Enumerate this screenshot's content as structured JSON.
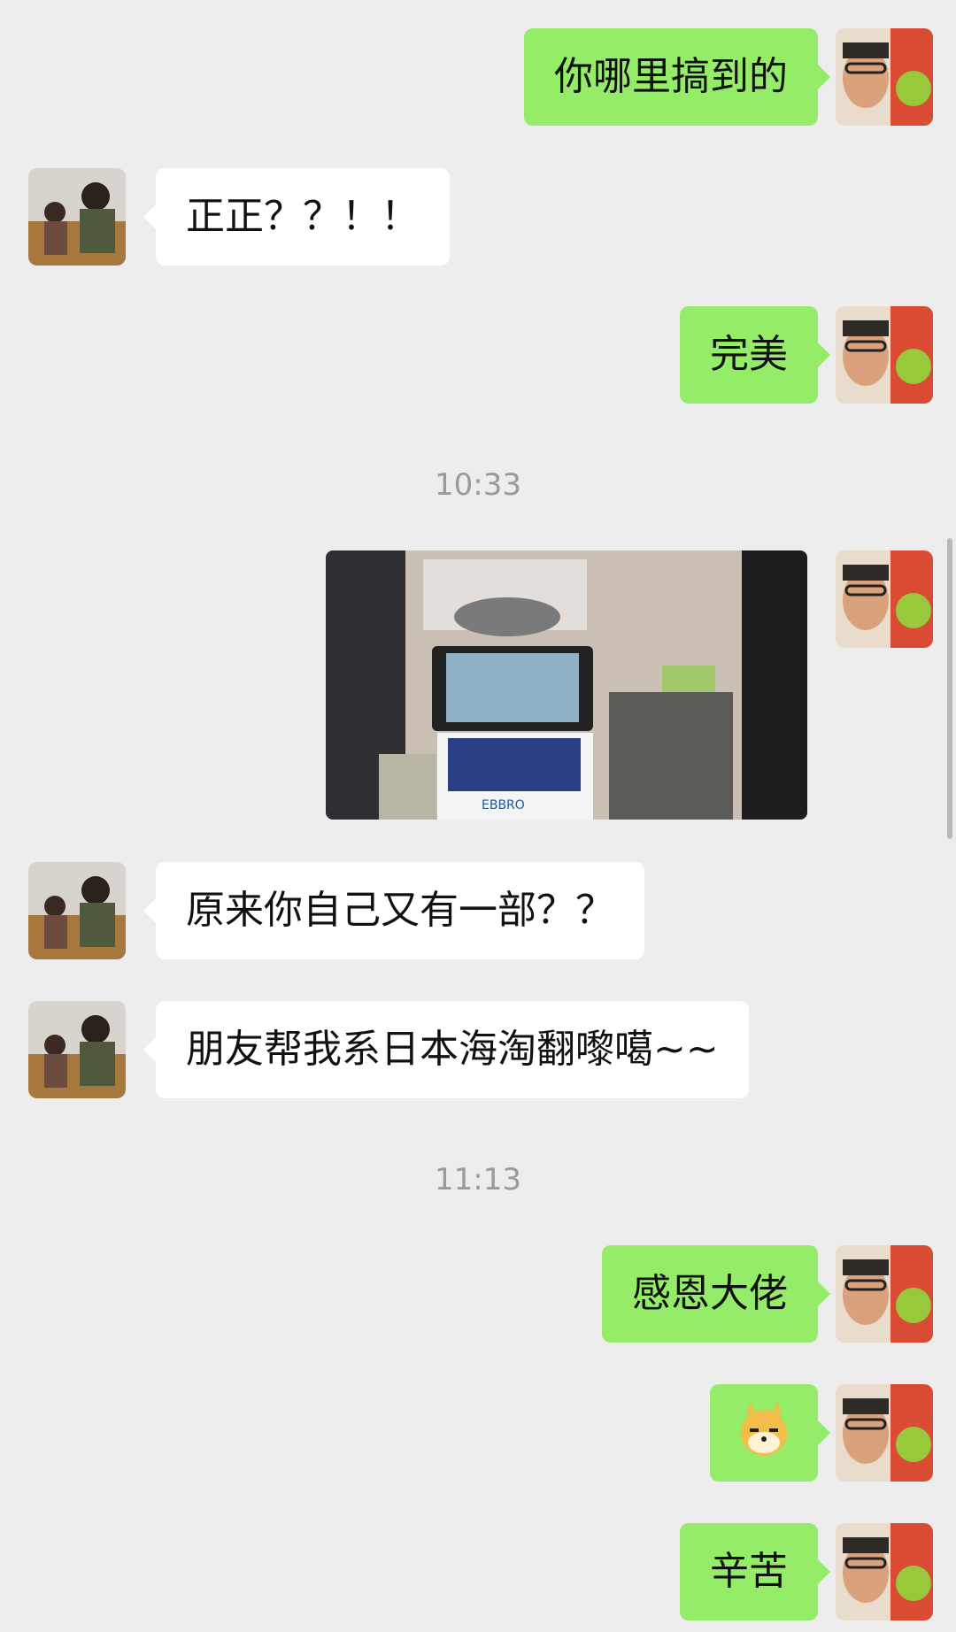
{
  "messages": [
    {
      "side": "right",
      "text": "你哪里搞到的"
    },
    {
      "side": "left",
      "text": "正正？？！！"
    },
    {
      "side": "right",
      "text": "完美"
    },
    {
      "time": "10:33"
    },
    {
      "side": "right",
      "type": "image",
      "image_desc": "toy-car-display-cases"
    },
    {
      "side": "left",
      "text": "原来你自己又有一部？？"
    },
    {
      "side": "left",
      "text": "朋友帮我系日本海淘翻嚟噶~~"
    },
    {
      "time": "11:13"
    },
    {
      "side": "right",
      "text": "感恩大佬"
    },
    {
      "side": "right",
      "type": "emoji",
      "emoji_name": "doge-emoji"
    },
    {
      "side": "right",
      "text": "辛苦"
    }
  ],
  "icons": {
    "left_avatar": "friend-avatar",
    "right_avatar": "self-avatar"
  },
  "colors": {
    "background": "#ededed",
    "self_bubble": "#95ec69",
    "friend_bubble": "#ffffff",
    "time_text": "#9a9a9a"
  }
}
